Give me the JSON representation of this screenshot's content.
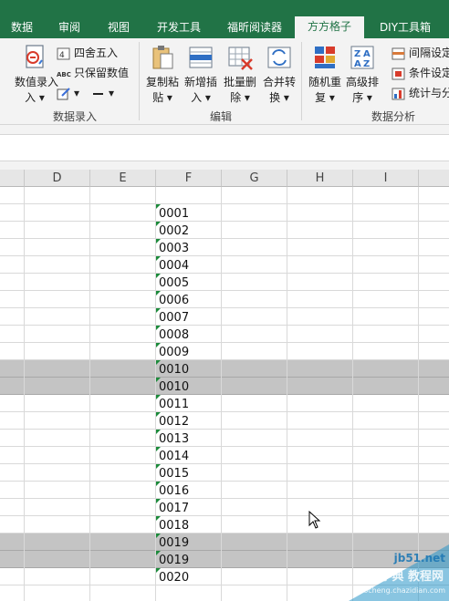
{
  "ribbon_tabs": [
    {
      "label": "数据",
      "active": false
    },
    {
      "label": "审阅",
      "active": false
    },
    {
      "label": "视图",
      "active": false
    },
    {
      "label": "开发工具",
      "active": false
    },
    {
      "label": "福昕阅读器",
      "active": false
    },
    {
      "label": "方方格子",
      "active": true
    },
    {
      "label": "DIY工具箱",
      "active": false
    }
  ],
  "groups": {
    "data_entry": {
      "label": "数据录入",
      "value_entry_button": "数值录入",
      "round_button": "四舍五入",
      "keep_values_button": "只保留数值"
    },
    "edit": {
      "label": "编辑",
      "copy_paste_button": "复制粘贴",
      "insert_button": "新增插入",
      "batch_delete_button": "批量删除",
      "merge_convert_button": "合并转换"
    },
    "analysis": {
      "label": "数据分析",
      "random_repeat_button": "随机重复",
      "advanced_sort_button": "高级排序",
      "interval_setting": "间隔设定",
      "condition_setting": "条件设定",
      "statistics": "统计与分"
    }
  },
  "columns": [
    "D",
    "E",
    "F",
    "G",
    "H",
    "I"
  ],
  "rows": [
    {
      "value": "",
      "highlight": false,
      "marker": false
    },
    {
      "value": "0001",
      "highlight": false,
      "marker": true
    },
    {
      "value": "0002",
      "highlight": false,
      "marker": true
    },
    {
      "value": "0003",
      "highlight": false,
      "marker": true
    },
    {
      "value": "0004",
      "highlight": false,
      "marker": true
    },
    {
      "value": "0005",
      "highlight": false,
      "marker": true
    },
    {
      "value": "0006",
      "highlight": false,
      "marker": true
    },
    {
      "value": "0007",
      "highlight": false,
      "marker": true
    },
    {
      "value": "0008",
      "highlight": false,
      "marker": true
    },
    {
      "value": "0009",
      "highlight": false,
      "marker": true
    },
    {
      "value": "0010",
      "highlight": true,
      "marker": true
    },
    {
      "value": "0010",
      "highlight": true,
      "marker": true
    },
    {
      "value": "0011",
      "highlight": false,
      "marker": true
    },
    {
      "value": "0012",
      "highlight": false,
      "marker": true
    },
    {
      "value": "0013",
      "highlight": false,
      "marker": true
    },
    {
      "value": "0014",
      "highlight": false,
      "marker": true
    },
    {
      "value": "0015",
      "highlight": false,
      "marker": true
    },
    {
      "value": "0016",
      "highlight": false,
      "marker": true
    },
    {
      "value": "0017",
      "highlight": false,
      "marker": true
    },
    {
      "value": "0018",
      "highlight": false,
      "marker": true
    },
    {
      "value": "0019",
      "highlight": true,
      "marker": true
    },
    {
      "value": "0019",
      "highlight": true,
      "marker": true
    },
    {
      "value": "0020",
      "highlight": false,
      "marker": true
    },
    {
      "value": "",
      "highlight": false,
      "marker": false
    }
  ],
  "watermark": {
    "line1": "jb51.net",
    "line2": "查字典 教程网",
    "line3": "jiaocheng.chazidian.com"
  },
  "colors": {
    "ribbon_green": "#217346",
    "highlight_row": "#c4c4c4",
    "cell_marker": "#1b8a3a"
  }
}
